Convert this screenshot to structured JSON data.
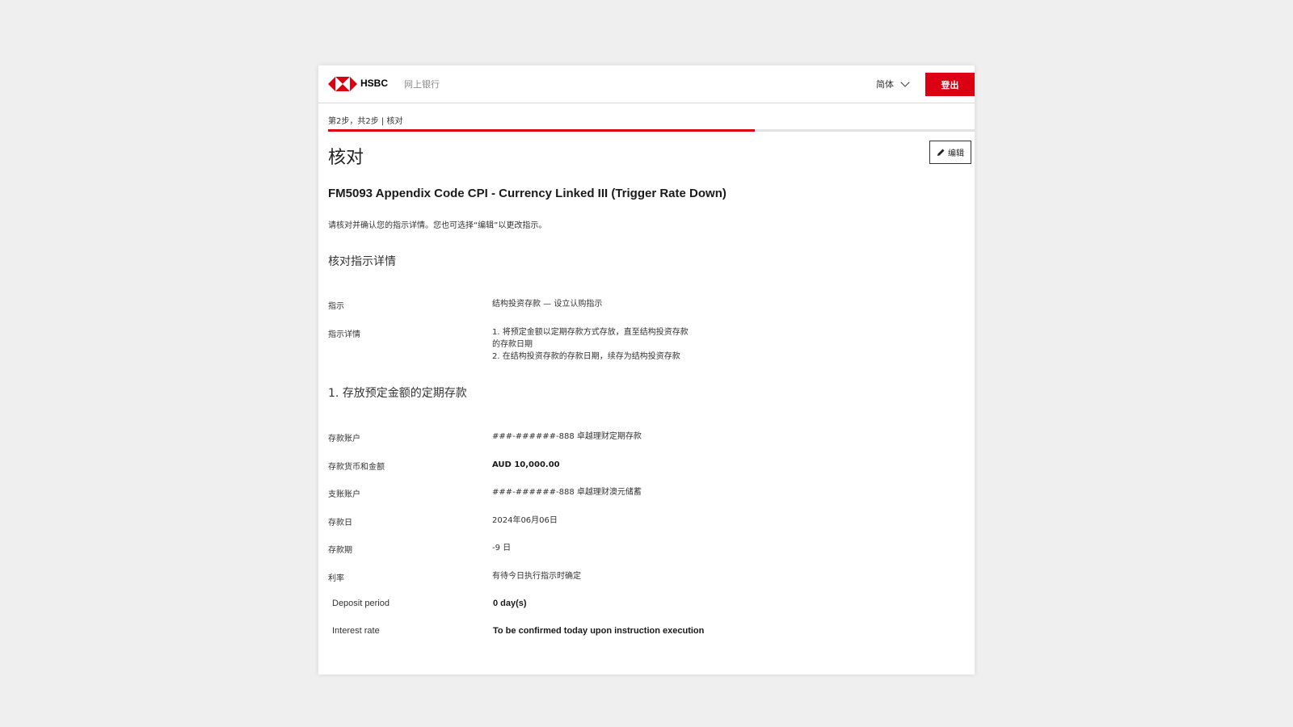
{
  "header": {
    "brand": "HSBC",
    "app_name": "网上银行",
    "language": "简体",
    "logout_label": "登出",
    "brand_color": "#db0011"
  },
  "step": {
    "text": "第2步，共2步 | 核对",
    "progress": 0.66
  },
  "page": {
    "title": "核对",
    "edit_label": "编辑",
    "product_name": "FM5093 Appendix Code CPI - Currency Linked III (Trigger Rate Down)",
    "intro": "请核对并确认您的指示详情。您也可选择“编辑”以更改指示。"
  },
  "instruction_section": {
    "title": "核对指示详情",
    "rows": [
      {
        "label": "指示",
        "value": "结构投资存款 — 设立认购指示"
      },
      {
        "label": "指示详情",
        "lines": [
          "1. 将预定金额以定期存款方式存放，直至结构投资存款",
          "的存款日期",
          "2. 在结构投资存款的存款日期，续存为结构投资存款"
        ]
      }
    ]
  },
  "deposit_section": {
    "title": "1. 存放预定金额的定期存款",
    "rows": [
      {
        "label": "存款账户",
        "value": "###-######-888 卓越理财定期存款"
      },
      {
        "label": "存款货币和金额",
        "value": "AUD 10,000.00"
      },
      {
        "label": "支账账户",
        "value": "###-######-888 卓越理财澳元储蓄"
      },
      {
        "label": "存款日",
        "value": "2024年06月06日"
      },
      {
        "label": "存款期",
        "value": "-9 日"
      },
      {
        "label": "利率",
        "value": "有待今日执行指示时确定"
      }
    ],
    "english_rows": [
      {
        "label": "Deposit period",
        "value": "0 day(s)"
      },
      {
        "label": "Interest rate",
        "value": "To be confirmed today upon instruction execution"
      }
    ]
  }
}
